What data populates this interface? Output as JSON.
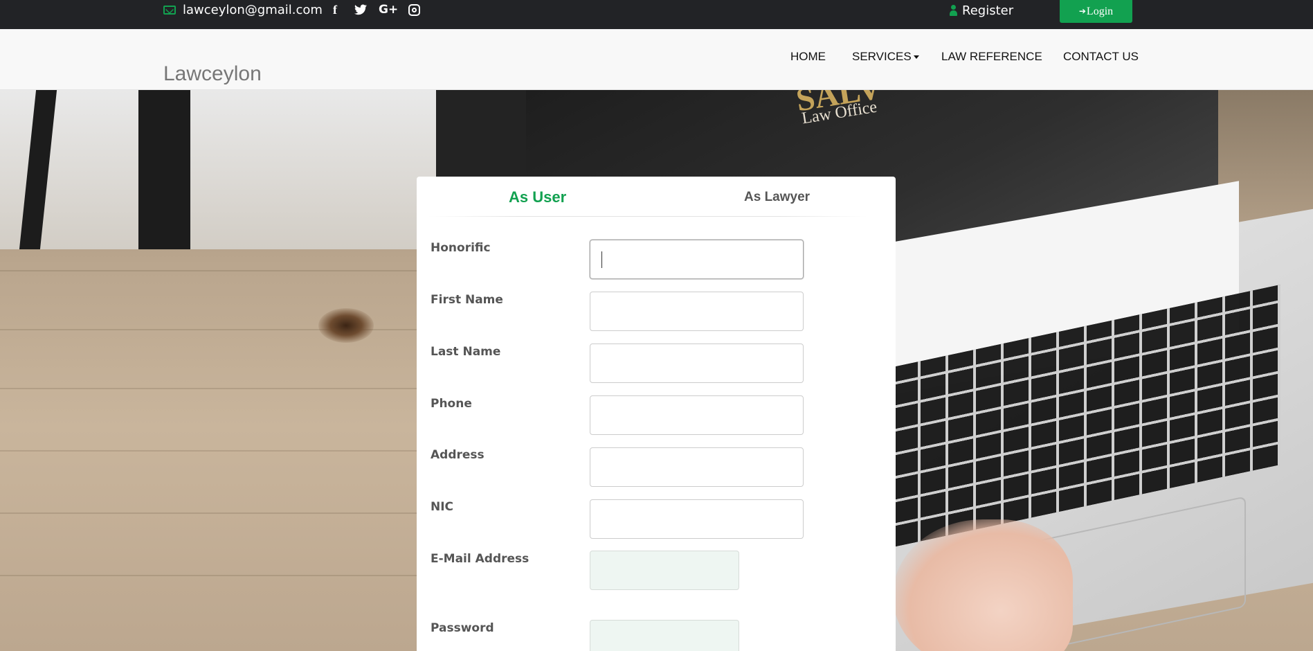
{
  "topbar": {
    "email": "lawceylon@gmail.com",
    "social": [
      "facebook-icon",
      "twitter-icon",
      "google-plus-icon",
      "instagram-icon"
    ],
    "register_label": "Register",
    "login_label": "Login"
  },
  "navbar": {
    "brand": "Lawceylon",
    "items": [
      {
        "label": "HOME"
      },
      {
        "label": "SERVICES"
      },
      {
        "label": "LAW REFERENCE"
      },
      {
        "label": "CONTACT US"
      }
    ]
  },
  "form": {
    "tabs": [
      {
        "label": "As User",
        "active": true
      },
      {
        "label": "As Lawyer",
        "active": false
      }
    ],
    "fields": [
      {
        "label": "Honorific",
        "value": ""
      },
      {
        "label": "First Name",
        "value": ""
      },
      {
        "label": "Last Name",
        "value": ""
      },
      {
        "label": "Phone",
        "value": ""
      },
      {
        "label": "Address",
        "value": ""
      },
      {
        "label": "NIC",
        "value": ""
      },
      {
        "label": "E-Mail Address",
        "value": ""
      },
      {
        "label": "Password",
        "value": ""
      }
    ]
  },
  "background_text": {
    "brand_partial": "SALV",
    "subtitle": "Law Office"
  },
  "colors": {
    "accent": "#12a150",
    "topbar": "#222326",
    "navbar": "#f8f8f8"
  }
}
